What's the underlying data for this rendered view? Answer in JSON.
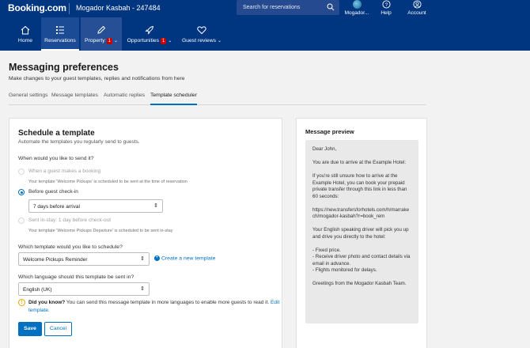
{
  "header": {
    "logo": "Booking.com",
    "property_name": "Mogador Kasbah - 247484",
    "search_placeholder": "Search for reservations",
    "account_items": [
      {
        "label": "Mogador...",
        "icon": "property-avatar-icon"
      },
      {
        "label": "Help",
        "icon": "help-icon"
      },
      {
        "label": "Account",
        "icon": "account-icon"
      }
    ]
  },
  "nav": {
    "items": [
      {
        "label": "Home",
        "icon": "home-icon"
      },
      {
        "label": "Reservations",
        "icon": "reservations-icon",
        "active": true
      },
      {
        "label": "Property",
        "icon": "property-icon",
        "badge": "1",
        "dropdown": true
      },
      {
        "label": "Opportunities",
        "icon": "rocket-icon",
        "badge": "1",
        "dropdown": true
      },
      {
        "label": "Guest reviews",
        "icon": "heart-icon",
        "dropdown": true
      }
    ]
  },
  "page": {
    "title": "Messaging preferences",
    "subtitle": "Make changes to your guest templates, replies and notifications from here",
    "tabs": [
      "General settings",
      "Message templates",
      "Automatic replies",
      "Template scheduler"
    ],
    "active_tab": "Template scheduler"
  },
  "schedule": {
    "title": "Schedule a template",
    "subtitle": "Automate the templates you regularly send to guests.",
    "when_label": "When would you like to send it?",
    "options": [
      {
        "label": "When a guest makes a booking",
        "hint": "Your template 'Welcome Pickups' is scheduled to be sent at the time of reservation",
        "disabled": true,
        "checked": false
      },
      {
        "label": "Before guest check-in",
        "disabled": false,
        "checked": true
      },
      {
        "label": "Sent in-stay: 1 day before check-out",
        "hint": "Your template 'Welcome Pickups Departure' is scheduled to be sent in-stay",
        "disabled": true,
        "checked": false
      }
    ],
    "timing_value": "7 days before arrival",
    "template_label": "Which template would you like to schedule?",
    "template_value": "Welcome Pickups Reminder",
    "create_link": "Create a new template",
    "language_label": "Which language should this template be sent in?",
    "language_value": "English (UK)",
    "tip_bold": "Did you know?",
    "tip_text": " You can send this message template in more languages to enable more guests to read it. ",
    "tip_link": "Edit template.",
    "save_label": "Save",
    "cancel_label": "Cancel"
  },
  "preview": {
    "title": "Message preview",
    "paragraphs": [
      "Dear John,",
      "You are due to arrive at the Example Hotel:",
      "If you're still unsure how to arrive at the Example Hotel, you can book your prepaid private transfer through this link in less than 60 seconds:",
      "https://new.transfersforhotels.com/h/marrakech/mogador-kasbah?r=book_rem",
      "Your English speaking driver will pick you up and drive you directly to the hotel:",
      "- Fixed price.\n- Receive driver photo and contact details via email in advance.\n- Flights monitored for delays.",
      "Greetings from the Mogador Kasbah Team."
    ]
  },
  "colors": {
    "brand_dark": "#003580",
    "accent": "#0071c2",
    "badge": "#cc0000",
    "tip": "#e8a700"
  }
}
